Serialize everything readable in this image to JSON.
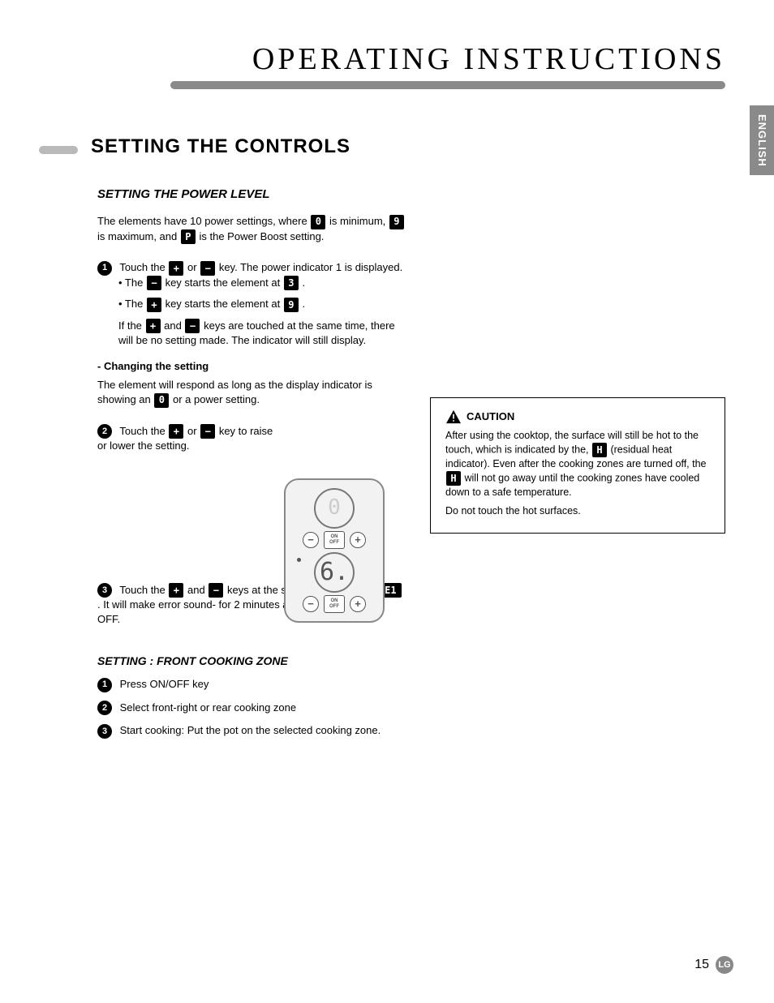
{
  "page": {
    "title": "OPERATING INSTRUCTIONS",
    "side_tab": "ENGLISH",
    "page_number": "15",
    "logo_text": "LG"
  },
  "section": {
    "heading": "SETTING THE CONTROLS",
    "sub": "SETTING THE POWER LEVEL"
  },
  "glyphs": {
    "zero": "0",
    "nine": "9",
    "P": "P",
    "three": "3",
    "plus": "+",
    "minus": "−",
    "H": "H",
    "E1": "E1",
    "six": "6."
  },
  "intro": {
    "t1": "The elements have 10 power settings, where",
    "t2": " is minimum, ",
    "t3": " is maximum, and ",
    "t4": " is the Power Boost setting."
  },
  "steps": {
    "s1_a": "Touch the ",
    "s1_b": " or ",
    "s1_c": " key. The power indicator 1 is displayed.",
    "s1_d": "• The ",
    "s1_e": " key starts the element at ",
    "s1_f": ".",
    "s1_g": "• The ",
    "s1_h": " key starts the element at ",
    "s1_i": ".",
    "s1_j": "If the ",
    "s1_k": " and ",
    "s1_l": " keys are touched at the same time, there will be no setting made. The indicator will still display.",
    "s2_title": "- Changing the setting",
    "s2_a": "The element will respond as long as the display indicator is showing an ",
    "s2_b": " or a power setting.",
    "s2_c": "Touch the ",
    "s2_d": " or ",
    "s2_e": " key to raise or lower the setting.",
    "s3_a": "Touch the ",
    "s3_b": " and ",
    "s3_c": " keys at the same time. Displays ",
    "s3_d": ". It will make error sound- for 2 minutes and will automatically OFF."
  },
  "actions": {
    "title": "SETTING : FRONT COOKING ZONE",
    "p1": "Press ON/OFF key",
    "p2": "Select front-right or rear cooking zone",
    "p3": "Start cooking: Put the pot on the selected cooking zone."
  },
  "caution": {
    "head": "CAUTION",
    "l1": "After using the cooktop, the surface will still be hot to the touch, which is indicated by the,",
    "l2": "(residual heat indicator). Even after the cooking zones are turned off, the ",
    "l3": " will not go away until the cooking zones have cooled down to a safe temperature.",
    "l4": "Do not touch the hot surfaces."
  },
  "control": {
    "on": "ON",
    "off": "OFF"
  }
}
